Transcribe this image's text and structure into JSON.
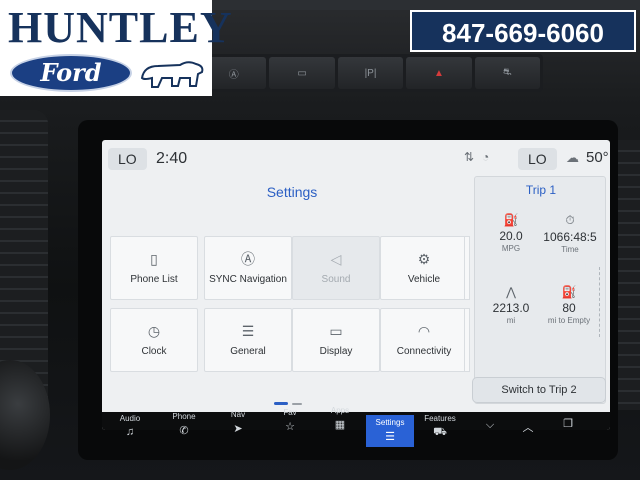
{
  "dealer": {
    "name": "HUNTLEY",
    "brand": "Ford",
    "phone": "847-669-6060"
  },
  "status_bar": {
    "left_climate": "LO",
    "time": "2:40",
    "right_climate": "LO",
    "outside_temp": "50°",
    "icons": [
      "signal-icon",
      "wifi-icon",
      "cloud-icon"
    ]
  },
  "settings": {
    "title": "Settings",
    "tiles": [
      {
        "label": "Phone List",
        "icon": "phone-list-icon",
        "enabled": true
      },
      {
        "label": "SYNC Navigation",
        "icon": "navigation-icon",
        "enabled": true
      },
      {
        "label": "Sound",
        "icon": "speaker-icon",
        "enabled": false
      },
      {
        "label": "Vehicle",
        "icon": "vehicle-icon",
        "enabled": true
      },
      {
        "label": "Clock",
        "icon": "clock-icon",
        "enabled": true
      },
      {
        "label": "General",
        "icon": "sliders-icon",
        "enabled": true
      },
      {
        "label": "Display",
        "icon": "display-icon",
        "enabled": true
      },
      {
        "label": "Connectivity",
        "icon": "wifi-icon",
        "enabled": true
      }
    ]
  },
  "trip": {
    "title": "Trip 1",
    "stats": [
      {
        "value": "20.0",
        "unit": "MPG"
      },
      {
        "value": "1066:48:5",
        "unit": "Time"
      },
      {
        "value": "2213.0",
        "unit": "mi"
      },
      {
        "value": "80",
        "unit": "mi to Empty"
      }
    ],
    "switch_label": "Switch to Trip 2"
  },
  "nav": [
    {
      "label": "Audio",
      "icon": "music-note-icon"
    },
    {
      "label": "Phone",
      "icon": "phone-icon"
    },
    {
      "label": "Nav",
      "icon": "navigation-arrow-icon"
    },
    {
      "label": "Fav",
      "icon": "star-icon"
    },
    {
      "label": "Apps",
      "icon": "apps-grid-icon"
    },
    {
      "label": "Settings",
      "icon": "settings-sliders-icon",
      "active": true
    },
    {
      "label": "Features",
      "icon": "car-icon"
    }
  ],
  "colors": {
    "accent": "#2b5fc4",
    "nav_active": "#2a62d6",
    "dealer_blue": "#16325c",
    "hazard": "#d63b3b"
  }
}
